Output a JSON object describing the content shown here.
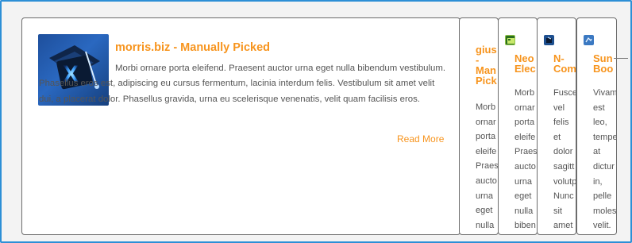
{
  "main": {
    "title": "morris.biz - Manually Picked",
    "excerpt": "Morbi ornare porta eleifend. Praesent auctor urna eget nulla bibendum vestibulum. Phasellus eros est, adipiscing eu cursus fermentum, lacinia interdum felis. Vestibulum sit amet velit dui, a placerat dolor. Phasellus gravida, urna eu scelerisque venenatis, velit quam facilisis eros.",
    "read_more": "Read More"
  },
  "columns": [
    {
      "title_lines": [
        "gius",
        "-",
        "Man",
        "Pick"
      ],
      "excerpt_lines": [
        "Morb",
        "ornar",
        "porta",
        "eleife",
        "Praes",
        "aucto",
        "urna",
        "eget",
        "nulla"
      ]
    },
    {
      "icon": "green-app-icon",
      "title_lines": [
        "Neo",
        "Elec"
      ],
      "excerpt_lines": [
        "Morb",
        "ornar",
        "porta",
        "eleife",
        "Praes",
        "aucto",
        "urna",
        "eget",
        "nulla",
        "biben"
      ]
    },
    {
      "icon": "blue-app-icon",
      "title_lines": [
        "N-",
        "Com"
      ],
      "excerpt_lines": [
        "Fusce",
        "vel",
        "felis",
        "et",
        "dolor",
        "sagitt",
        "volutp",
        "Nunc",
        "sit",
        "amet"
      ]
    },
    {
      "icon": "blue-app-icon",
      "title_lines": [
        "Sun",
        "Boo"
      ],
      "excerpt_lines": [
        "Vivam",
        "est",
        "leo,",
        "tempe",
        "at",
        "dictur",
        "in,",
        "pelle",
        "moles",
        "velit."
      ]
    }
  ]
}
